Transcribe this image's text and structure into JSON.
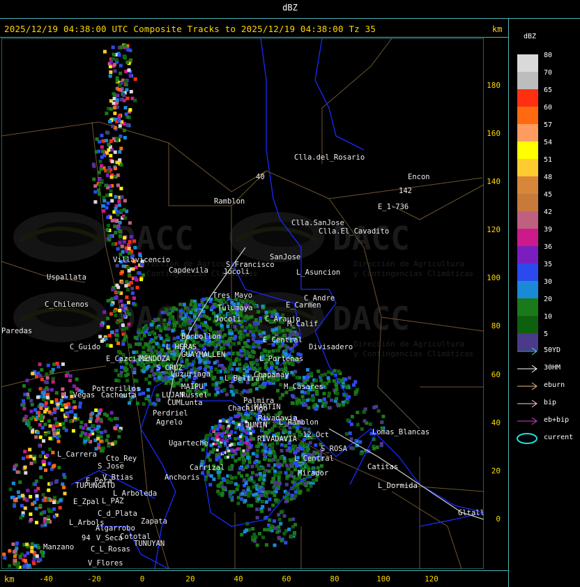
{
  "window_title": "dBZ",
  "header": {
    "title": "2025/12/19 04:38:00 UTC Composite Tracks to 2025/12/19 04:38:00 Tz 35",
    "km_top": "km",
    "km_bottom": "km"
  },
  "axes": {
    "x_ticks": [
      "-40",
      "-20",
      "0",
      "20",
      "40",
      "60",
      "80",
      "100",
      "120"
    ],
    "y_ticks": [
      "180",
      "160",
      "140",
      "120",
      "100",
      "80",
      "60",
      "40",
      "20",
      "0"
    ]
  },
  "watermark": {
    "brand": "DACC",
    "line1": "Dirección de Agricultura",
    "line2": "y Contingencias Climáticas"
  },
  "places": [
    "Clla.del_Rosario",
    "Encon",
    "142",
    "E_1-736",
    "Ramblon",
    "Clla.SanJose",
    "Clla.El_Cavadito",
    "40",
    "Villavicencio",
    "Capdevila",
    "S_Francisco",
    "Jocoli",
    "SanJose",
    "L_Asuncion",
    "Uspallata",
    "Tres_Mayo",
    "C_Andre",
    "C_Chilenos",
    "Tulumaya",
    "E_Carmen",
    "Paredas",
    "Jocoli",
    "C_Araujo",
    "M_Calif",
    "Borbollon",
    "E_Central",
    "Divisadero",
    "C_Guido",
    "L_HERAS",
    "GUAYMALLEN",
    "E_Cazcillo",
    "MENDOZA",
    "L_Portenas",
    "S_CRUZ",
    "Luzuriaga",
    "Chapanay",
    "L_Beltran",
    "MAIPU",
    "M_Casares",
    "Potrerillos",
    "Russel",
    "Cacheuta",
    "Palmira",
    "L_Vegas",
    "Chachingo",
    "LUJAN",
    "CUMLunta",
    "Perdriel",
    "S_MARTIN",
    "Rivadavia",
    "Agrelo",
    "L_Ramblon",
    "JUNIN",
    "Ugarteche",
    "12_Oct",
    "Lomas_Blancas",
    "L_Carrera",
    "Cto_Rey",
    "RIVADAVIA",
    "S_Jose",
    "S_ROSA",
    "Carrizal",
    "Catitas",
    "L_Central",
    "L_Dormida",
    "Mirador",
    "V_Btias",
    "Anchoris",
    "E_Pera",
    "TUPUNGATO",
    "L_Arboleda",
    "Gltallary",
    "E_Zpal",
    "L_PAZ",
    "C_d_Plata",
    "L_Arbols",
    "Zapata",
    "Algarrobo",
    "V_Seca",
    "Cototal",
    "TUNUYAN",
    "Manzano",
    "C_L_Rosas",
    "94",
    "V_Flores"
  ],
  "legend": {
    "title": "dBZ",
    "values": [
      "80",
      "70",
      "65",
      "60",
      "57",
      "54",
      "51",
      "48",
      "45",
      "42",
      "39",
      "36",
      "35",
      "30",
      "20",
      "10",
      "5"
    ],
    "colors": [
      "#d9d9d9",
      "#bdbdbd",
      "#ff3010",
      "#ff6a10",
      "#ff9a60",
      "#ffff00",
      "#ffcc30",
      "#d8873a",
      "#c87a3a",
      "#c06080",
      "#cc1a8a",
      "#7a1ec0",
      "#2a4af0",
      "#1a8ad8",
      "#1a7a1a",
      "#0e600e",
      "#4a3a8a"
    ]
  },
  "tracks": [
    {
      "label": "50YD",
      "color": "#40d8d8"
    },
    {
      "label": "30HM",
      "color": "#ffffff"
    },
    {
      "label": "eburn",
      "color": "#e8c080"
    },
    {
      "label": "bip",
      "color": "#ffc8d8"
    },
    {
      "label": "eb+bip",
      "color": "#d040d0"
    },
    {
      "label": "current",
      "color": "#20e0e0"
    }
  ]
}
